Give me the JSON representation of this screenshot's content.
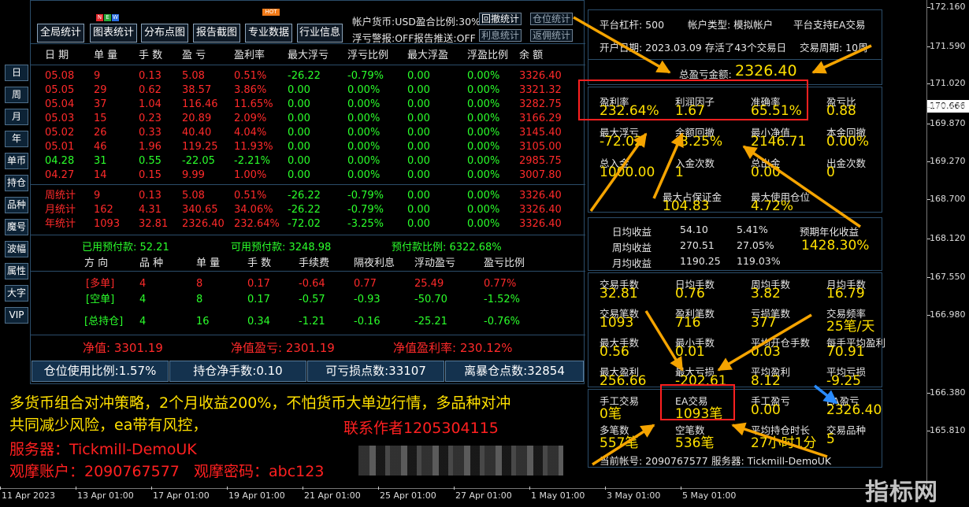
{
  "side_buttons": [
    "日",
    "周",
    "月",
    "年",
    "单币",
    "持仓",
    "品种",
    "魔号",
    "波幅",
    "属性",
    "大字",
    "VIP"
  ],
  "toolbar": {
    "buttons": [
      "全局统计",
      "图表统计",
      "分布点图",
      "报告截图",
      "专业数据",
      "行业信息"
    ],
    "new_badge": [
      "N",
      "E",
      "W"
    ],
    "hot_badge": "HOT",
    "account_line1": "帐户货币:USD盈合比例:30%",
    "account_line2": "浮亏警报:OFF报告推送:OFF",
    "btn_withdraw_stats": "回撤统计",
    "btn_position_stats": "仓位统计",
    "btn_interest_stats": "利息统计",
    "btn_rebate_stats": "返佣统计"
  },
  "table": {
    "headers": [
      "日 期",
      "单 量",
      "手 数",
      "盈 亏",
      "盈利率",
      "最大浮亏",
      "浮亏比例",
      "最大浮盈",
      "浮盈比例",
      "余 额"
    ],
    "rows": [
      {
        "c": "red",
        "v": [
          "05.08",
          "9",
          "0.13",
          "5.08",
          "0.51%",
          "-26.22",
          "-0.79%",
          "0.00",
          "0.00%",
          "3326.40"
        ]
      },
      {
        "c": "red",
        "v": [
          "05.05",
          "29",
          "0.62",
          "38.57",
          "3.86%",
          "0.00",
          "0.00%",
          "0.00",
          "0.00%",
          "3321.32"
        ]
      },
      {
        "c": "red",
        "v": [
          "05.04",
          "37",
          "1.04",
          "116.46",
          "11.65%",
          "0.00",
          "0.00%",
          "0.00",
          "0.00%",
          "3282.75"
        ]
      },
      {
        "c": "red",
        "v": [
          "05.03",
          "15",
          "0.23",
          "20.89",
          "2.09%",
          "0.00",
          "0.00%",
          "0.00",
          "0.00%",
          "3166.29"
        ]
      },
      {
        "c": "red",
        "v": [
          "05.02",
          "26",
          "0.33",
          "40.40",
          "4.04%",
          "0.00",
          "0.00%",
          "0.00",
          "0.00%",
          "3145.40"
        ]
      },
      {
        "c": "red",
        "v": [
          "05.01",
          "46",
          "1.96",
          "119.25",
          "11.93%",
          "0.00",
          "0.00%",
          "0.00",
          "0.00%",
          "3105.00"
        ]
      },
      {
        "c": "grn",
        "v": [
          "04.28",
          "31",
          "0.55",
          "-22.05",
          "-2.21%",
          "0.00",
          "0.00%",
          "0.00",
          "0.00%",
          "2985.75"
        ]
      },
      {
        "c": "red",
        "v": [
          "04.27",
          "14",
          "0.15",
          "9.99",
          "1.00%",
          "0.00",
          "0.00%",
          "0.00",
          "0.00%",
          "3007.80"
        ]
      }
    ],
    "summary": [
      {
        "c": "red",
        "v": [
          "周统计",
          "9",
          "0.13",
          "5.08",
          "0.51%",
          "-26.22",
          "-0.79%",
          "0.00",
          "0.00%",
          "3326.40"
        ]
      },
      {
        "c": "red",
        "v": [
          "月统计",
          "162",
          "4.31",
          "340.65",
          "34.06%",
          "-26.22",
          "-0.79%",
          "0.00",
          "0.00%",
          "3326.40"
        ]
      },
      {
        "c": "red",
        "v": [
          "年统计",
          "1093",
          "32.81",
          "2326.40",
          "232.64%",
          "-72.02",
          "-3.25%",
          "0.00",
          "0.00%",
          "3326.40"
        ]
      }
    ]
  },
  "margin_line": {
    "used": "已用预付款: 52.21",
    "free": "可用预付款: 3248.98",
    "ratio": "预付款比例: 6322.68%"
  },
  "positions": {
    "headers": [
      "方 向",
      "品 种",
      "单 量",
      "手 数",
      "手续费",
      "隔夜利息",
      "浮动盈亏",
      "盈亏比例"
    ],
    "rows": [
      {
        "c": "red",
        "v": [
          "[多单]",
          "4",
          "8",
          "0.17",
          "-0.64",
          "0.77",
          "25.49",
          "0.77%"
        ]
      },
      {
        "c": "grn",
        "v": [
          "[空单]",
          "4",
          "8",
          "0.17",
          "-0.57",
          "-0.93",
          "-50.70",
          "-1.52%"
        ]
      },
      {
        "c": "grn",
        "v": [
          "[总持仓]",
          "4",
          "16",
          "0.34",
          "-1.21",
          "-0.16",
          "-25.21",
          "-0.76%"
        ]
      }
    ]
  },
  "equity": {
    "net": "净值: 3301.19",
    "net_pl": "净值盈亏: 2301.19",
    "net_rate": "净值盈利率: 230.12%"
  },
  "bottom_buttons": [
    "仓位使用比例:1.57%",
    "持仓净手数:0.10",
    "可亏损点数:33107",
    "离暴仓点数:32854"
  ],
  "right": {
    "leverage": "平台杠杆: 500",
    "acct_type": "帐户类型: 模拟帐户",
    "ea_support": "平台支持EA交易",
    "open_date": "开户日期: 2023.03.09 存活了43个交易日",
    "period": "交易周期: 10周",
    "total_pl_label": "总盈亏金额:",
    "total_pl": "2326.40",
    "metrics": [
      {
        "l": "盈利率",
        "v": "232.64%"
      },
      {
        "l": "利润因子",
        "v": "1.67"
      },
      {
        "l": "准确率",
        "v": "65.51%"
      },
      {
        "l": "盈亏比",
        "v": "0.88"
      },
      {
        "l": "最大浮亏",
        "v": "-72.02"
      },
      {
        "l": "余额回撤",
        "v": "-3.25%"
      },
      {
        "l": "最小净值",
        "v": "2146.71"
      },
      {
        "l": "本金回撤",
        "v": "0.00%"
      },
      {
        "l": "总入金",
        "v": "1000.00"
      },
      {
        "l": "入金次数",
        "v": "1"
      },
      {
        "l": "总出金",
        "v": "0.00"
      },
      {
        "l": "出金次数",
        "v": "0"
      }
    ],
    "margin": [
      {
        "l": "最大占保证金",
        "v": "104.83"
      },
      {
        "l": "最大使用仓位",
        "v": "4.72%"
      }
    ],
    "avg": [
      {
        "l": "日均收益",
        "a": "54.10",
        "b": "5.41%"
      },
      {
        "l": "周均收益",
        "a": "270.51",
        "b": "27.05%"
      },
      {
        "l": "月均收益",
        "a": "1190.25",
        "b": "119.03%"
      }
    ],
    "annual_label": "预期年化收益",
    "annual": "1428.30%",
    "stats": [
      {
        "l": "交易手数",
        "v": "32.81"
      },
      {
        "l": "日均手数",
        "v": "0.76"
      },
      {
        "l": "周均手数",
        "v": "3.82"
      },
      {
        "l": "月均手数",
        "v": "16.79"
      },
      {
        "l": "交易笔数",
        "v": "1093"
      },
      {
        "l": "盈利笔数",
        "v": "716"
      },
      {
        "l": "亏损笔数",
        "v": "377"
      },
      {
        "l": "交易频率",
        "v": "25笔/天"
      },
      {
        "l": "最大手数",
        "v": "0.56"
      },
      {
        "l": "最小手数",
        "v": "0.01"
      },
      {
        "l": "平均开仓手数",
        "v": "0.03"
      },
      {
        "l": "每手平均盈利",
        "v": "70.91"
      },
      {
        "l": "最大盈利",
        "v": "256.66"
      },
      {
        "l": "最大亏损",
        "v": "-202.61"
      },
      {
        "l": "平均盈利",
        "v": "8.12"
      },
      {
        "l": "平均亏损",
        "v": "-9.25"
      }
    ],
    "stats2": [
      {
        "l": "手工交易",
        "v": "0笔"
      },
      {
        "l": "EA交易",
        "v": "1093笔"
      },
      {
        "l": "手工盈亏",
        "v": "0.00"
      },
      {
        "l": "EA盈亏",
        "v": "2326.40"
      },
      {
        "l": "多笔数",
        "v": "557笔"
      },
      {
        "l": "空笔数",
        "v": "536笔"
      },
      {
        "l": "平均持仓时长",
        "v": "27小时1分"
      },
      {
        "l": "交易品种",
        "v": "5"
      }
    ],
    "current_acct": "当前帐号: 2090767577",
    "server": "服务器: Tickmill-DemoUK"
  },
  "price_axis": [
    "172.160",
    "171.590",
    "171.020",
    "170.666",
    "170.430",
    "169.870",
    "169.270",
    "168.700",
    "168.120",
    "167.550",
    "166.980",
    "166.380",
    "165.810"
  ],
  "current_price": "170.666",
  "time_axis": [
    "11 Apr 2023",
    "13 Apr 01:00",
    "17 Apr 01:00",
    "19 Apr 01:00",
    "21 Apr 01:00",
    "25 Apr 01:00",
    "27 Apr 01:00",
    "1 May 01:00",
    "3 May 01:00",
    "5 May 01:00"
  ],
  "overlay": {
    "line1": "多货币组合对冲策略，2个月收益200%，不怕货币大单边行情，多品种对冲",
    "line2": "共同减少风险，ea带有风控，",
    "contact": "联系作者1205304115",
    "server": "服务器：Tickmill-DemoUK",
    "watch": "观摩账户：2090767577   观摩密码：abc123"
  },
  "watermark": "指标网",
  "colors": {
    "red": "#ff2a2a",
    "green": "#2bff2b",
    "yellow": "#ffe000",
    "panel_border": "#2b4d6a",
    "button_bg": "#14324e"
  }
}
